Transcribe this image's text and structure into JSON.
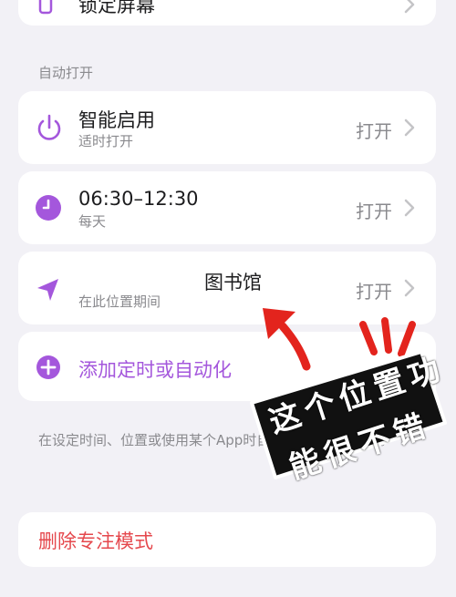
{
  "top_item": {
    "label": "锁定屏幕"
  },
  "auto_open": {
    "section_label": "自动打开"
  },
  "rows": [
    {
      "title": "智能启用",
      "subtitle": "适时打开",
      "value": "打开",
      "icon": "power-icon"
    },
    {
      "title": "06:30–12:30",
      "subtitle": "每天",
      "value": "打开",
      "icon": "clock-icon"
    },
    {
      "title": "图书馆",
      "subtitle": "在此位置期间",
      "value": "打开",
      "icon": "location-arrow-icon"
    }
  ],
  "add_automation": {
    "label": "添加定时或自动化",
    "icon": "plus-circle-icon"
  },
  "footnote": {
    "text": "在设定时间、位置或使用某个App时自动打开此专注模式。"
  },
  "delete_focus": {
    "label": "删除专注模式"
  },
  "annotation": {
    "line1": "这个位置功",
    "line2": "能很不错"
  },
  "colors": {
    "accent": "#a457dc",
    "background": "#f2f1f6",
    "danger": "#e5484d",
    "annotation_red": "#e3241d"
  }
}
